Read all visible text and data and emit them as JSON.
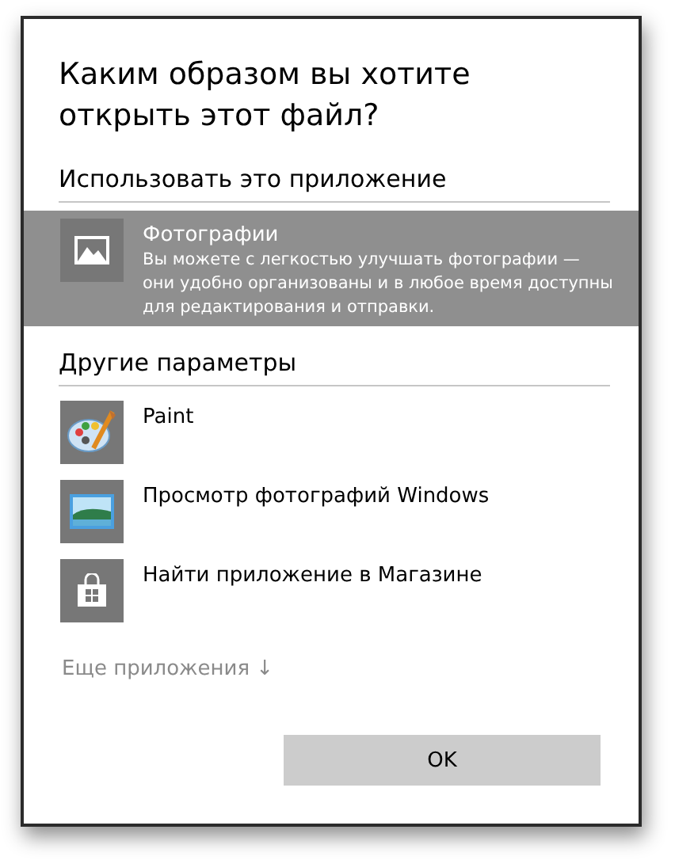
{
  "dialog": {
    "title": "Каким образом вы хотите открыть этот файл?"
  },
  "sections": [
    {
      "heading": "Использовать это приложение",
      "apps": [
        {
          "kind": "photos",
          "name": "Фотографии",
          "description": "Вы можете с легкостью улучшать фотографии — они удобно организованы и в любое время доступны для редактирования и отправки.",
          "selected": true
        }
      ]
    },
    {
      "heading": "Другие параметры",
      "apps": [
        {
          "kind": "paint",
          "name": "Paint",
          "selected": false
        },
        {
          "kind": "viewer",
          "name": "Просмотр фотографий Windows",
          "selected": false
        },
        {
          "kind": "store",
          "name": "Найти приложение в Магазине",
          "selected": false
        }
      ]
    }
  ],
  "more_link": "Еще приложения ↓",
  "buttons": [
    {
      "label": "OK"
    }
  ]
}
